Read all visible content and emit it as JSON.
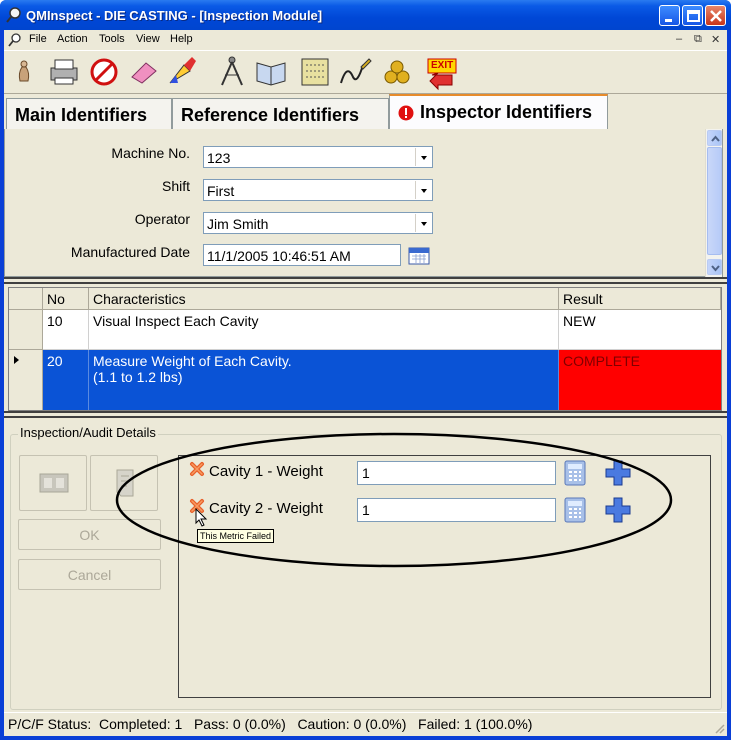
{
  "window": {
    "title": "QMInspect - DIE CASTING - [Inspection Module]"
  },
  "menubar": {
    "items": [
      "File",
      "Action",
      "Tools",
      "View",
      "Help"
    ]
  },
  "toolbar": {
    "tools": [
      "inspect-icon",
      "print-icon",
      "cancel-icon",
      "eraser-icon",
      "brush-icon",
      "compass-icon",
      "book-icon",
      "data-icon",
      "signature-icon",
      "coins-icon",
      "exit-icon"
    ],
    "exit_label": "EXIT"
  },
  "tabs": {
    "main": "Main Identifiers",
    "reference": "Reference Identifiers",
    "inspector": "Inspector Identifiers"
  },
  "identifiers": {
    "machine_label": "Machine No.",
    "machine_value": "123",
    "shift_label": "Shift",
    "shift_value": "First",
    "operator_label": "Operator",
    "operator_value": "Jim Smith",
    "date_label": "Manufactured Date",
    "date_value": "11/1/2005 10:46:51 AM"
  },
  "grid": {
    "headers": {
      "no": "No",
      "characteristics": "Characteristics",
      "result": "Result"
    },
    "rows": [
      {
        "no": "10",
        "line1": "Visual Inspect Each Cavity",
        "line2": "",
        "result": "NEW"
      },
      {
        "no": "20",
        "line1": "Measure Weight of Each Cavity.",
        "line2": "(1.1 to 1.2 lbs)",
        "result": "COMPLETE"
      }
    ],
    "colors": {
      "selected": "#0a53d6",
      "complete": "#ff0000"
    }
  },
  "details": {
    "title": "Inspection/Audit Details",
    "ok_label": "OK",
    "cancel_label": "Cancel",
    "metrics": [
      {
        "label": "Cavity 1 - Weight",
        "value": "1"
      },
      {
        "label": "Cavity 2 - Weight",
        "value": "1"
      }
    ],
    "tooltip": "This Metric Failed"
  },
  "status": {
    "text": "P/C/F Status:  Completed: 1   Pass: 0 (0.0%)   Caution: 0 (0.0%)   Failed: 1 (100.0%)"
  }
}
